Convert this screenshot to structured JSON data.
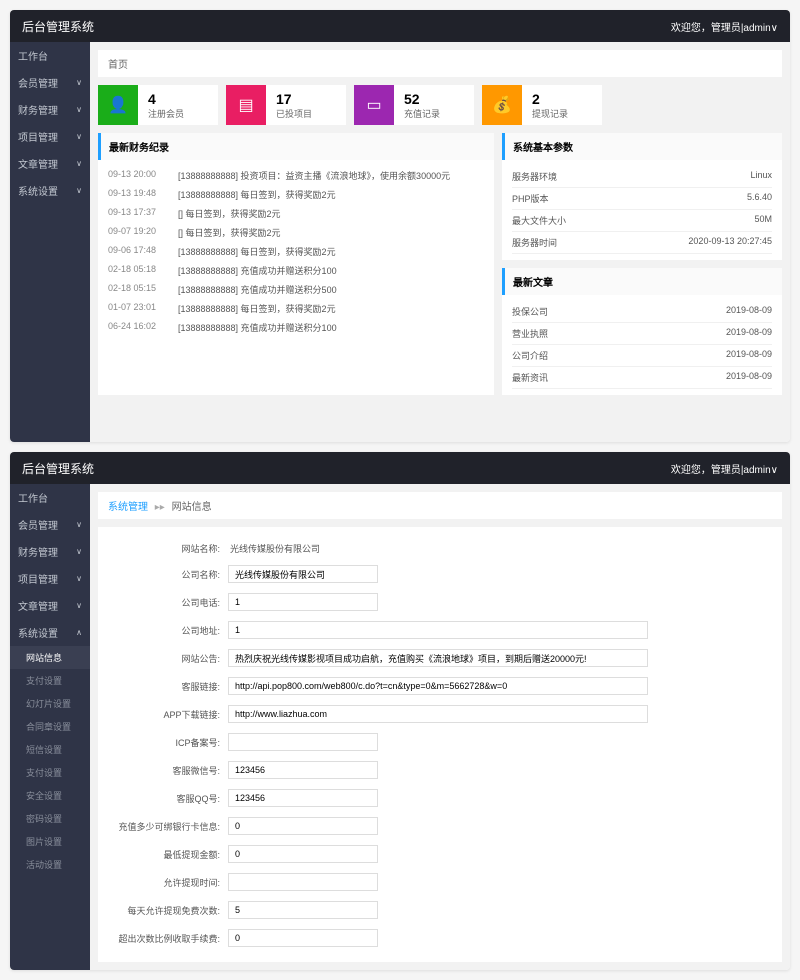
{
  "header": {
    "title": "后台管理系统",
    "welcome": "欢迎您，管理员|admin"
  },
  "sidebar": {
    "items": [
      {
        "label": "工作台"
      },
      {
        "label": "会员管理"
      },
      {
        "label": "财务管理"
      },
      {
        "label": "项目管理"
      },
      {
        "label": "文章管理"
      },
      {
        "label": "系统设置"
      }
    ],
    "subs": [
      {
        "label": "网站信息"
      },
      {
        "label": "支付设置"
      },
      {
        "label": "幻灯片设置"
      },
      {
        "label": "合同章设置"
      },
      {
        "label": "短信设置"
      },
      {
        "label": "支付设置"
      },
      {
        "label": "安全设置"
      },
      {
        "label": "密码设置"
      },
      {
        "label": "图片设置"
      },
      {
        "label": "活动设置"
      }
    ]
  },
  "screen1": {
    "breadcrumb": "首页",
    "stats": [
      {
        "num": "4",
        "label": "注册会员"
      },
      {
        "num": "17",
        "label": "已投项目"
      },
      {
        "num": "52",
        "label": "充值记录"
      },
      {
        "num": "2",
        "label": "提现记录"
      }
    ],
    "logs_title": "最新财务纪录",
    "logs": [
      {
        "time": "09-13 20:00",
        "text": "[13888888888] 投资项目：益资主播《流浪地球》，使用余额30000元"
      },
      {
        "time": "09-13 19:48",
        "text": "[13888888888] 每日签到，获得奖励2元"
      },
      {
        "time": "09-13 17:37",
        "text": "[] 每日签到，获得奖励2元"
      },
      {
        "time": "09-07 19:20",
        "text": "[] 每日签到，获得奖励2元"
      },
      {
        "time": "09-06 17:48",
        "text": "[13888888888] 每日签到，获得奖励2元"
      },
      {
        "time": "02-18 05:18",
        "text": "[13888888888] 充值成功并赠送积分100"
      },
      {
        "time": "02-18 05:15",
        "text": "[13888888888] 充值成功并赠送积分500"
      },
      {
        "time": "01-07 23:01",
        "text": "[13888888888] 每日签到，获得奖励2元"
      },
      {
        "time": "06-24 16:02",
        "text": "[13888888888] 充值成功并赠送积分100"
      }
    ],
    "sysparam_title": "系统基本参数",
    "sysparam": [
      {
        "k": "服务器环境",
        "v": "Linux"
      },
      {
        "k": "PHP版本",
        "v": "5.6.40"
      },
      {
        "k": "最大文件大小",
        "v": "50M"
      },
      {
        "k": "服务器时间",
        "v": "2020-09-13 20:27:45"
      }
    ],
    "articles_title": "最新文章",
    "articles": [
      {
        "k": "投保公司",
        "v": "2019-08-09"
      },
      {
        "k": "营业执照",
        "v": "2019-08-09"
      },
      {
        "k": "公司介绍",
        "v": "2019-08-09"
      },
      {
        "k": "最新资讯",
        "v": "2019-08-09"
      }
    ]
  },
  "screen2": {
    "breadcrumb": {
      "a": "系统管理",
      "b": "网站信息"
    },
    "fields": [
      {
        "label": "网站名称:",
        "value": "光线传媒股份有限公司",
        "type": "text"
      },
      {
        "label": "公司名称:",
        "value": "光线传媒股份有限公司",
        "type": "input"
      },
      {
        "label": "公司电话:",
        "value": "1",
        "type": "input"
      },
      {
        "label": "公司地址:",
        "value": "1",
        "type": "input-wide"
      },
      {
        "label": "网站公告:",
        "value": "热烈庆祝光线传媒影视项目成功启航，充值购买《流浪地球》项目，到期后赠送20000元!",
        "type": "input-wide"
      },
      {
        "label": "客服链接:",
        "value": "http://api.pop800.com/web800/c.do?t=cn&type=0&m=5662728&w=0",
        "type": "input-wide"
      },
      {
        "label": "APP下载链接:",
        "value": "http://www.liazhua.com",
        "type": "input-wide"
      },
      {
        "label": "ICP备案号:",
        "value": "",
        "type": "input"
      },
      {
        "label": "客服微信号:",
        "value": "123456",
        "type": "input"
      },
      {
        "label": "客服QQ号:",
        "value": "123456",
        "type": "input"
      },
      {
        "label": "充值多少可绑银行卡信息:",
        "value": "0",
        "type": "input"
      },
      {
        "label": "最低提现金额:",
        "value": "0",
        "type": "input"
      },
      {
        "label": "允许提现时间:",
        "value": "",
        "type": "input"
      },
      {
        "label": "每天允许提现免费次数:",
        "value": "5",
        "type": "input"
      },
      {
        "label": "超出次数比例收取手续费:",
        "value": "0",
        "type": "input"
      }
    ]
  }
}
